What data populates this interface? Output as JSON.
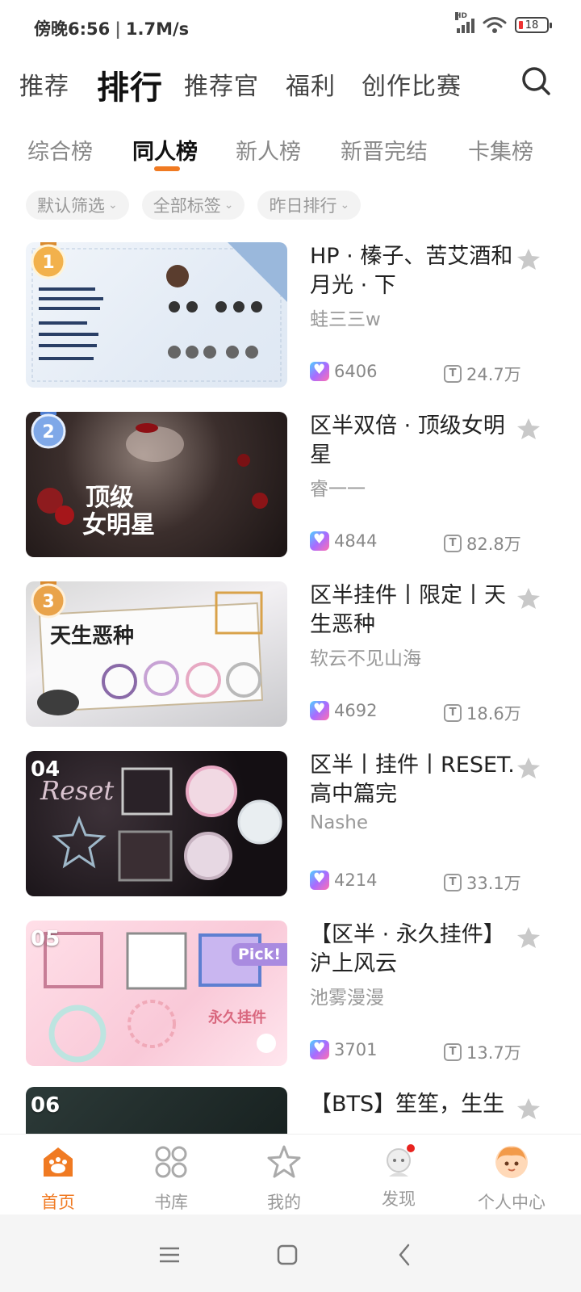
{
  "status_bar": {
    "time": "傍晚6:56",
    "speed": "1.7M/s",
    "signal_label": "HD",
    "battery": "18"
  },
  "top_nav": {
    "tabs": [
      "推荐",
      "排行",
      "推荐官",
      "福利",
      "创作比赛"
    ],
    "active_index": 1,
    "search_icon": "search-icon"
  },
  "sub_nav": {
    "tabs": [
      "综合榜",
      "同人榜",
      "新人榜",
      "新晋完结",
      "卡集榜"
    ],
    "active_index": 1,
    "accent_color": "#f07a22"
  },
  "filters": [
    "默认筛选",
    "全部标签",
    "昨日排行"
  ],
  "items": [
    {
      "rank": "1",
      "title": "HP · 榛子、苦艾酒和月光 · 下",
      "author": "蛙三三w",
      "likes": "6406",
      "reads": "24.7万",
      "badge": ""
    },
    {
      "rank": "2",
      "title": "区半双倍 · 顶级女明星",
      "author": "睿一一",
      "likes": "4844",
      "reads": "82.8万",
      "badge": ""
    },
    {
      "rank": "3",
      "title": "区半挂件丨限定丨天生恶种",
      "author": "软云不见山海",
      "likes": "4692",
      "reads": "18.6万",
      "badge": ""
    },
    {
      "rank": "04",
      "title": "区半丨挂件丨RESET.高中篇完",
      "author": "Nashe",
      "likes": "4214",
      "reads": "33.1万",
      "badge": ""
    },
    {
      "rank": "05",
      "title": "【区半 · 永久挂件】沪上风云",
      "author": "池雾漫漫",
      "likes": "3701",
      "reads": "13.7万",
      "badge": "Pick!"
    },
    {
      "rank": "06",
      "title": "【BTS】笙笙，生生",
      "author": "",
      "likes": "",
      "reads": "",
      "badge": ""
    }
  ],
  "bottom_nav": {
    "items": [
      "首页",
      "书库",
      "我的",
      "发现",
      "个人中心"
    ],
    "active_index": 0
  },
  "colors": {
    "accent": "#f07a22",
    "gold_medal": "#f2b14c",
    "silver_medal": "#7fa8e8",
    "bronze_medal": "#e9a34a",
    "notification_dot": "#e8231f"
  }
}
